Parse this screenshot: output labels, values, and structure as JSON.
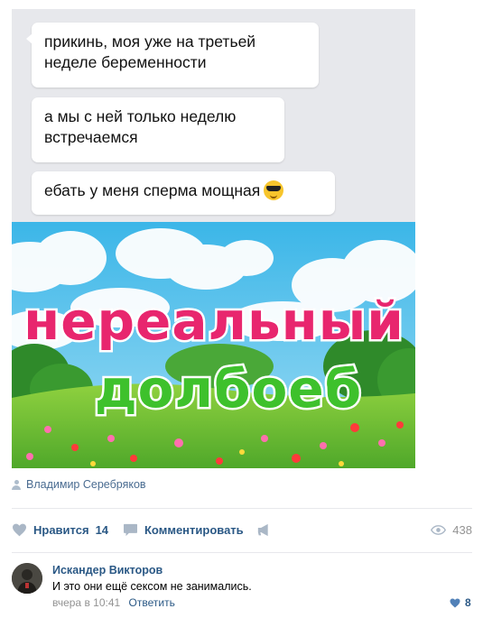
{
  "chat": {
    "messages": [
      "прикинь,    моя уже на третьей неделе беременности",
      "а мы с ней только неделю встречаемся",
      "ебать у меня сперма мощная"
    ],
    "emoji": "sunglasses-emoji"
  },
  "picture": {
    "line1": "нереальный",
    "line2": "долбоеб"
  },
  "post": {
    "author": "Владимир Серебряков",
    "like_label": "Нравится",
    "like_count": "14",
    "comment_label": "Комментировать",
    "views": "438"
  },
  "comment": {
    "author": "Искандер Викторов",
    "text": "И это они ещё сексом не занимались.",
    "time": "вчера в 10:41",
    "reply_label": "Ответить",
    "likes": "8"
  },
  "colors": {
    "link": "#2a5885",
    "muted": "#939393",
    "chat_bg": "#e7e8ec"
  }
}
